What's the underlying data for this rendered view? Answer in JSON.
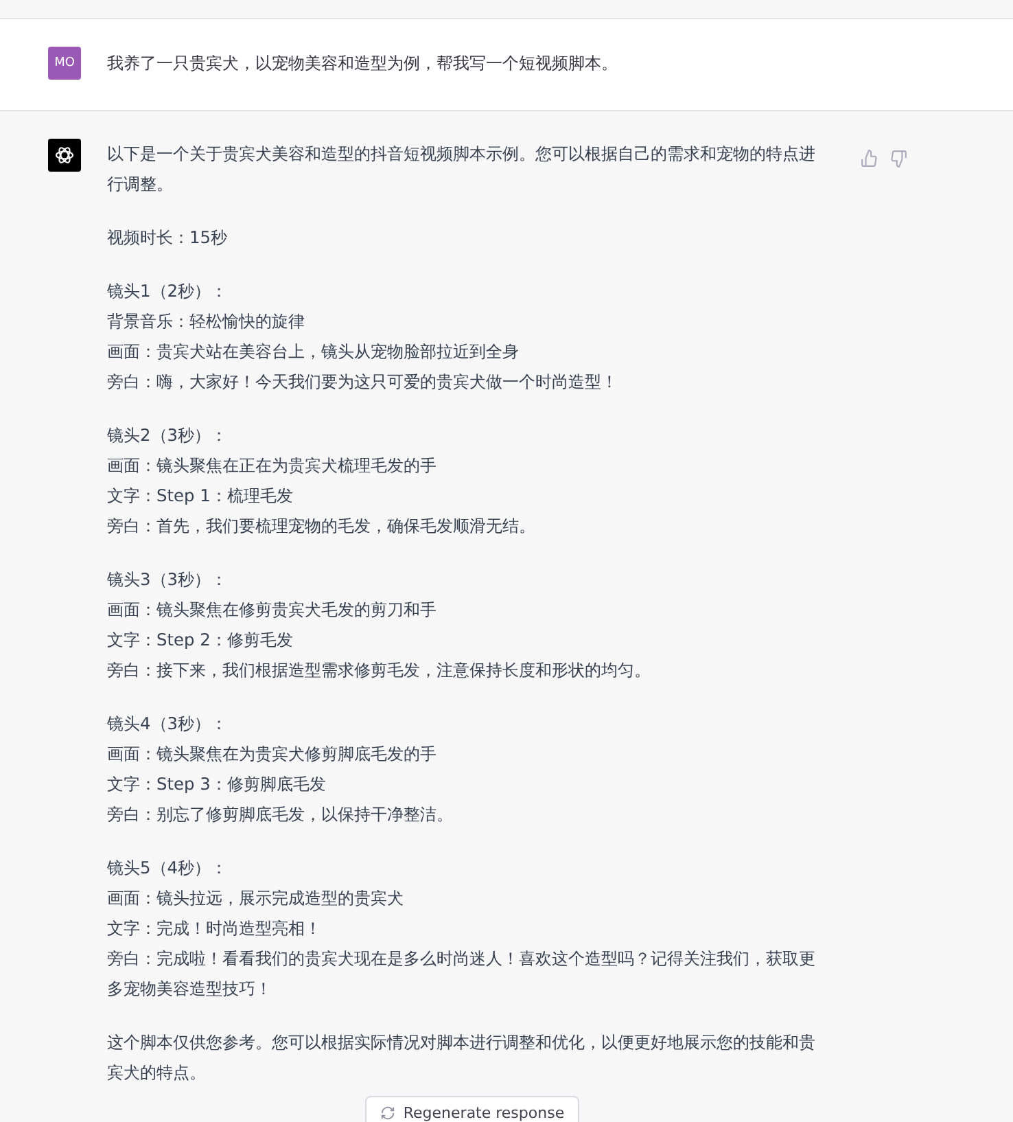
{
  "user_message": {
    "avatar": "MO",
    "text": "我养了一只贵宾犬，以宠物美容和造型为例，帮我写一个短视频脚本。"
  },
  "assistant_message": {
    "paragraphs": [
      {
        "lines": [
          "以下是一个关于贵宾犬美容和造型的抖音短视频脚本示例。您可以根据自己的需求和宠物的特点进行调整。"
        ]
      },
      {
        "lines": [
          "视频时长：15秒"
        ]
      },
      {
        "lines": [
          "镜头1（2秒）：",
          "背景音乐：轻松愉快的旋律",
          "画面：贵宾犬站在美容台上，镜头从宠物脸部拉近到全身",
          "旁白：嗨，大家好！今天我们要为这只可爱的贵宾犬做一个时尚造型！"
        ]
      },
      {
        "lines": [
          "镜头2（3秒）：",
          "画面：镜头聚焦在正在为贵宾犬梳理毛发的手",
          "文字：Step 1：梳理毛发",
          "旁白：首先，我们要梳理宠物的毛发，确保毛发顺滑无结。"
        ]
      },
      {
        "lines": [
          "镜头3（3秒）：",
          "画面：镜头聚焦在修剪贵宾犬毛发的剪刀和手",
          "文字：Step 2：修剪毛发",
          "旁白：接下来，我们根据造型需求修剪毛发，注意保持长度和形状的均匀。"
        ]
      },
      {
        "lines": [
          "镜头4（3秒）：",
          "画面：镜头聚焦在为贵宾犬修剪脚底毛发的手",
          "文字：Step 3：修剪脚底毛发",
          "旁白：别忘了修剪脚底毛发，以保持干净整洁。"
        ]
      },
      {
        "lines": [
          "镜头5（4秒）：",
          "画面：镜头拉远，展示完成造型的贵宾犬",
          "文字：完成！时尚造型亮相！",
          "旁白：完成啦！看看我们的贵宾犬现在是多么时尚迷人！喜欢这个造型吗？记得关注我们，获取更多宠物美容造型技巧！"
        ]
      },
      {
        "lines": [
          "这个脚本仅供您参考。您可以根据实际情况对脚本进行调整和优化，以便更好地展示您的技能和贵宾犬的特点。"
        ]
      }
    ]
  },
  "regenerate_button": {
    "label": "Regenerate response"
  }
}
